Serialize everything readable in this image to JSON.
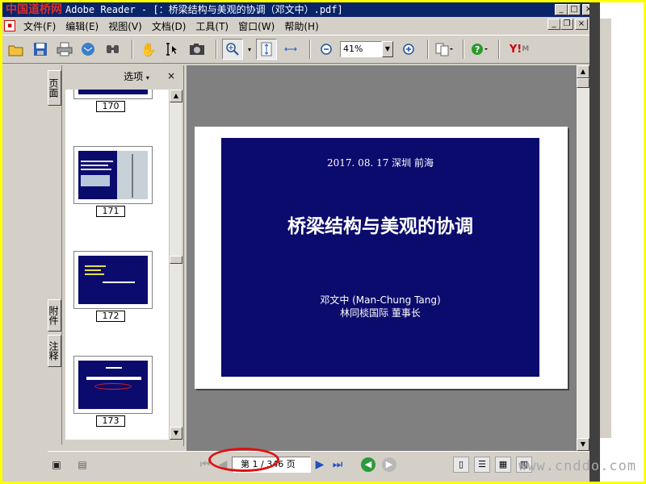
{
  "window": {
    "watermark_logo": "中国道桥网",
    "title": "Adobe Reader - [：桥梁结构与美观的协调（邓文中）.pdf]",
    "buttons": {
      "minimize": "_",
      "maximize": "□",
      "close": "×",
      "doc_minimize": "_",
      "doc_restore": "❐",
      "doc_close": "×"
    }
  },
  "menu": {
    "items": [
      "文件(F)",
      "编辑(E)",
      "视图(V)",
      "文档(D)",
      "工具(T)",
      "窗口(W)",
      "帮助(H)"
    ]
  },
  "toolbar": {
    "zoom_value": "41%",
    "icons": [
      "open-icon",
      "save-icon",
      "print-icon",
      "email-icon",
      "search-icon",
      "hand-tool-icon",
      "select-text-icon",
      "snapshot-icon",
      "zoom-in-icon",
      "fit-page-icon",
      "fit-width-icon",
      "zoom-out-minus-icon",
      "zoom-in-plus-icon",
      "page-layout-icon",
      "help-icon",
      "yahoo-icon"
    ],
    "yahoo_label": "Y!"
  },
  "sidebar": {
    "tabs": [
      "页面",
      "附件",
      "注释"
    ],
    "options_label": "选项",
    "close_label": "×",
    "thumbnails": [
      {
        "page": "170"
      },
      {
        "page": "171"
      },
      {
        "page": "172"
      },
      {
        "page": "173"
      }
    ]
  },
  "slide": {
    "date_location": "2017. 08. 17  深圳  前海",
    "title": "桥梁结构与美观的协调",
    "author": "邓文中  (Man-Chung Tang)",
    "org": "林同棪国际  董事长",
    "background": "#0b0b6e"
  },
  "status": {
    "page_indicator": "第 1 / 346 页",
    "accent": "#e01010"
  },
  "overlay": {
    "watermark_text": "www.cnddo.com"
  }
}
